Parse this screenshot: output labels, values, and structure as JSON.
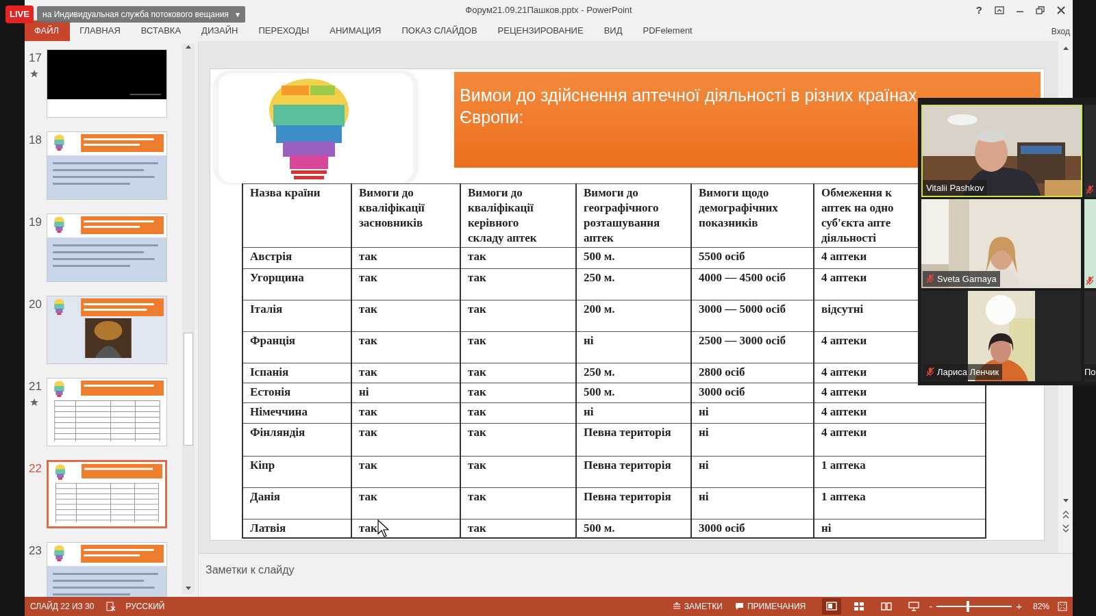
{
  "live_badge": "LIVE",
  "stream_tooltip": {
    "text": "на Индивидуальная служба потокового вещания",
    "caret": "▾"
  },
  "window": {
    "title": "Форум21.09.21Пашков.pptx - PowerPoint",
    "help": "?",
    "sign_in": "Вход"
  },
  "ribbon_tabs": [
    {
      "label": "ФАЙЛ",
      "selected": true
    },
    {
      "label": "ГЛАВНАЯ",
      "selected": false
    },
    {
      "label": "ВСТАВКА",
      "selected": false
    },
    {
      "label": "ДИЗАЙН",
      "selected": false
    },
    {
      "label": "ПЕРЕХОДЫ",
      "selected": false
    },
    {
      "label": "АНИМАЦИЯ",
      "selected": false
    },
    {
      "label": "ПОКАЗ СЛАЙДОВ",
      "selected": false
    },
    {
      "label": "РЕЦЕНЗИРОВАНИЕ",
      "selected": false
    },
    {
      "label": "ВИД",
      "selected": false
    },
    {
      "label": "PDFelement",
      "selected": false
    }
  ],
  "slides": [
    {
      "number": "17",
      "starred": true,
      "selected": false,
      "kind": "blank"
    },
    {
      "number": "18",
      "starred": false,
      "selected": false,
      "kind": "text"
    },
    {
      "number": "19",
      "starred": false,
      "selected": false,
      "kind": "text"
    },
    {
      "number": "20",
      "starred": false,
      "selected": false
    },
    {
      "number": "21",
      "starred": true,
      "selected": false,
      "kind": "table"
    },
    {
      "number": "22",
      "starred": false,
      "selected": true,
      "kind": "table"
    },
    {
      "number": "23",
      "starred": false,
      "selected": false,
      "kind": "text"
    }
  ],
  "slide": {
    "title": "Вимои до здійснення аптечної діяльності в різних країнах Європи:",
    "header": [
      [
        "Назва країни"
      ],
      [
        "Вимоги до",
        "кваліфікації",
        "засновників"
      ],
      [
        "Вимоги до",
        "кваліфікації",
        "керівного",
        "складу аптек"
      ],
      [
        "Вимоги до",
        "географічного",
        "розташування",
        "аптек"
      ],
      [
        "Вимоги щодо",
        "демографічних",
        "показників"
      ],
      [
        "Обмеження к",
        "аптек на одно",
        "суб'єкта апте",
        "діяльності"
      ]
    ],
    "rows": [
      [
        "Австрія",
        "так",
        "так",
        "500 м.",
        "5500 осіб",
        "4 аптеки"
      ],
      [
        "Угорщина",
        "так",
        "так",
        "250 м.",
        "4000 — 4500 осіб",
        "4 аптеки"
      ],
      [
        "Італія",
        "так",
        "так",
        "200 м.",
        "3000 — 5000 осіб",
        "відсутні"
      ],
      [
        "Франція",
        "так",
        "так",
        "ні",
        "2500 — 3000 осіб",
        "4 аптеки"
      ],
      [
        "Іспанія",
        "так",
        "так",
        "250 м.",
        "2800 осіб",
        "4 аптеки"
      ],
      [
        "Естонія",
        "ні",
        "так",
        "500 м.",
        "3000 осіб",
        "4 аптеки"
      ],
      [
        "Німеччина",
        "так",
        "так",
        "ні",
        "ні",
        "4 аптеки"
      ],
      [
        "Фінляндія",
        "так",
        "так",
        "Певна територія",
        "ні",
        "4 аптеки"
      ],
      [
        "Кіпр",
        "так",
        "так",
        "Певна територія",
        "ні",
        "1 аптека"
      ],
      [
        "Данія",
        "так",
        "так",
        "Певна територія",
        "ні",
        "1 аптека"
      ],
      [
        "Латвія",
        "так",
        "так",
        "500 м.",
        "3000 осіб",
        "ні"
      ]
    ]
  },
  "notes_placeholder": "Заметки к слайду",
  "video": {
    "tiles": [
      {
        "name": "Vitalii Pashkov",
        "muted": false,
        "speaking": true
      },
      {
        "name": "Sveta Garnaya",
        "muted": true,
        "speaking": false
      },
      {
        "name": "Лариса Ленчик",
        "muted": true,
        "speaking": false
      }
    ],
    "side_tiles": [
      {
        "muted": true
      },
      {
        "muted": true
      },
      {
        "name": "По",
        "muted": false
      }
    ]
  },
  "status_bar": {
    "slide_info": "СЛАЙД 22 ИЗ 30",
    "language": "РУССКИЙ",
    "notes": "ЗАМЕТКИ",
    "comments": "ПРИМЕЧАНИЯ",
    "views": [
      {
        "kind": "normal",
        "selected": true
      },
      {
        "kind": "sorter",
        "selected": false
      },
      {
        "kind": "reading",
        "selected": false
      },
      {
        "kind": "slideshow",
        "selected": false
      }
    ],
    "zoom": {
      "out": "-",
      "in": "+",
      "level": 0.42,
      "reading": "82%"
    }
  }
}
